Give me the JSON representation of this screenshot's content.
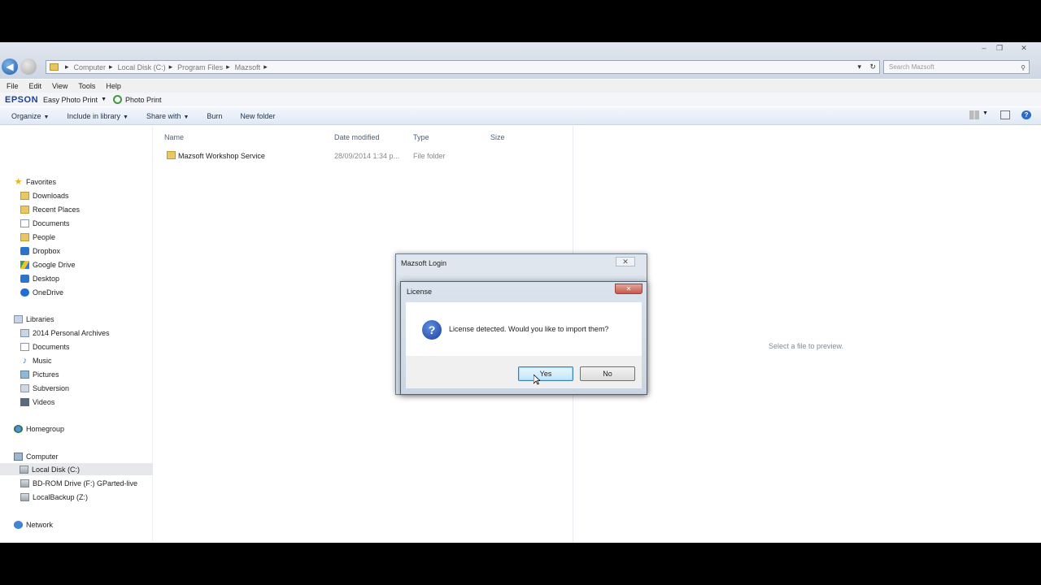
{
  "window": {
    "controls": [
      "–",
      "❐",
      "✕"
    ],
    "address": {
      "crumbs": [
        "Computer",
        "Local Disk (C:)",
        "Program Files",
        "Mazsoft"
      ],
      "search_placeholder": "Search Mazsoft"
    },
    "menu": [
      "File",
      "Edit",
      "View",
      "Tools",
      "Help"
    ],
    "epson": {
      "logo": "EPSON",
      "easy_photo_print": "Easy Photo Print",
      "photo_print": "Photo Print"
    },
    "commands": [
      "Organize",
      "Include in library",
      "Share with",
      "Burn",
      "New folder"
    ]
  },
  "nav": {
    "favorites": {
      "header": "Favorites",
      "items": [
        "Downloads",
        "Recent Places",
        "Documents",
        "People",
        "Dropbox",
        "Google Drive",
        "Desktop",
        "OneDrive"
      ]
    },
    "libraries": {
      "header": "Libraries",
      "items": [
        "2014 Personal Archives",
        "Documents",
        "Music",
        "Pictures",
        "Subversion",
        "Videos"
      ]
    },
    "homegroup": "Homegroup",
    "computer": {
      "header": "Computer",
      "items": [
        "Local Disk (C:)",
        "BD-ROM Drive (F:) GParted-live",
        "LocalBackup (Z:)"
      ]
    },
    "network": "Network"
  },
  "filelist": {
    "columns": [
      "Name",
      "Date modified",
      "Type",
      "Size"
    ],
    "rows": [
      {
        "name": "Mazsoft Workshop Service",
        "date": "28/09/2014 1:34 p...",
        "type": "File folder",
        "size": ""
      }
    ]
  },
  "preview": {
    "text": "Select a file to preview."
  },
  "login_dialog": {
    "title": "Mazsoft Login",
    "close": "✕"
  },
  "license_dialog": {
    "title": "License",
    "close": "✕",
    "icon": "question-icon",
    "message": "License detected. Would you like to import them?",
    "yes": "Yes",
    "no": "No"
  }
}
